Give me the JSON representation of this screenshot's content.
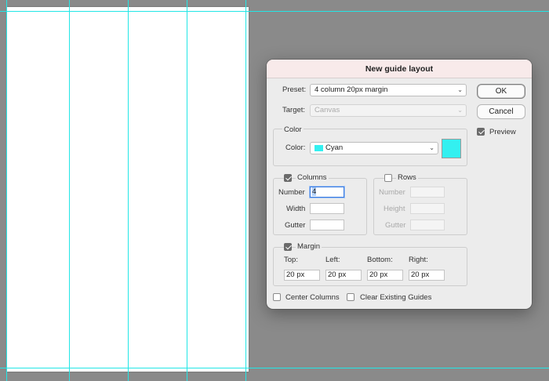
{
  "canvas": {
    "guide_color": "#22e6e6",
    "background": "#ffffff"
  },
  "dialog": {
    "title": "New guide layout",
    "preset": {
      "label": "Preset:",
      "value": "4 column 20px margin"
    },
    "target": {
      "label": "Target:",
      "value": "Canvas"
    },
    "color_group": {
      "legend": "Color",
      "label": "Color:",
      "value": "Cyan",
      "swatch": "#33f0f0"
    },
    "columns": {
      "legend": "Columns",
      "checked": true,
      "number_label": "Number",
      "number_value": "4",
      "width_label": "Width",
      "width_value": "",
      "gutter_label": "Gutter",
      "gutter_value": ""
    },
    "rows": {
      "legend": "Rows",
      "checked": false,
      "number_label": "Number",
      "height_label": "Height",
      "gutter_label": "Gutter"
    },
    "margin": {
      "legend": "Margin",
      "checked": true,
      "top_label": "Top:",
      "left_label": "Left:",
      "bottom_label": "Bottom:",
      "right_label": "Right:",
      "top": "20 px",
      "left": "20 px",
      "bottom": "20 px",
      "right": "20 px"
    },
    "center_columns": {
      "label": "Center Columns",
      "checked": false
    },
    "clear_guides": {
      "label": "Clear Existing Guides",
      "checked": false
    },
    "ok_label": "OK",
    "cancel_label": "Cancel",
    "preview": {
      "label": "Preview",
      "checked": true
    }
  }
}
